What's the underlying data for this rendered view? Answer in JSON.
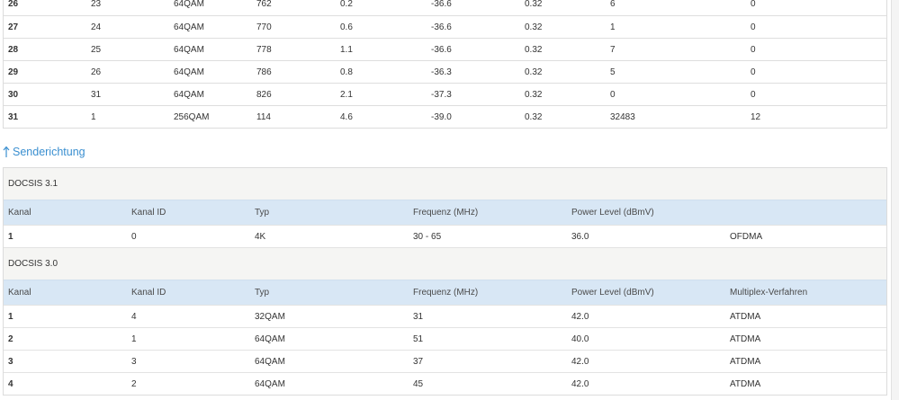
{
  "downstream_rows": [
    [
      "26",
      "23",
      "64QAM",
      "762",
      "0.2",
      "-36.6",
      "0.32",
      "6",
      "0"
    ],
    [
      "27",
      "24",
      "64QAM",
      "770",
      "0.6",
      "-36.6",
      "0.32",
      "1",
      "0"
    ],
    [
      "28",
      "25",
      "64QAM",
      "778",
      "1.1",
      "-36.6",
      "0.32",
      "7",
      "0"
    ],
    [
      "29",
      "26",
      "64QAM",
      "786",
      "0.8",
      "-36.3",
      "0.32",
      "5",
      "0"
    ],
    [
      "30",
      "31",
      "64QAM",
      "826",
      "2.1",
      "-37.3",
      "0.32",
      "0",
      "0"
    ],
    [
      "31",
      "1",
      "256QAM",
      "114",
      "4.6",
      "-39.0",
      "0.32",
      "32483",
      "12"
    ]
  ],
  "upstream": {
    "heading": "Senderichtung",
    "docsis31": {
      "title": "DOCSIS 3.1",
      "headers": [
        "Kanal",
        "Kanal ID",
        "Typ",
        "Frequenz (MHz)",
        "Power Level (dBmV)",
        ""
      ],
      "rows": [
        [
          "1",
          "0",
          "4K",
          "30 - 65",
          "36.0",
          "OFDMA"
        ]
      ]
    },
    "docsis30": {
      "title": "DOCSIS 3.0",
      "headers": [
        "Kanal",
        "Kanal ID",
        "Typ",
        "Frequenz (MHz)",
        "Power Level (dBmV)",
        "Multiplex-Verfahren"
      ],
      "rows": [
        [
          "1",
          "4",
          "32QAM",
          "31",
          "42.0",
          "ATDMA"
        ],
        [
          "2",
          "1",
          "64QAM",
          "51",
          "40.0",
          "ATDMA"
        ],
        [
          "3",
          "3",
          "64QAM",
          "37",
          "42.0",
          "ATDMA"
        ],
        [
          "4",
          "2",
          "64QAM",
          "45",
          "42.0",
          "ATDMA"
        ]
      ]
    }
  },
  "colors": {
    "link": "#3a8fd0",
    "header_bg": "#d8e7f5",
    "group_bg": "#f5f5f3"
  },
  "icons": {
    "heading_icon": "arrow-up-icon"
  }
}
